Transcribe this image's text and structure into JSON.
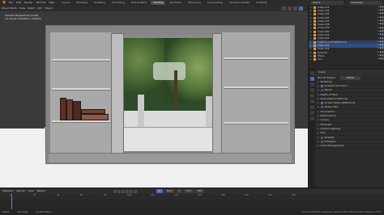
{
  "app": {
    "logo": "blender-logo-icon"
  },
  "menu": [
    "File",
    "Edit",
    "Render",
    "Window",
    "Help"
  ],
  "workspace_tabs": [
    {
      "label": "Layout",
      "active": false
    },
    {
      "label": "Modeling",
      "active": false
    },
    {
      "label": "Sculpting",
      "active": false
    },
    {
      "label": "UV Editing",
      "active": false
    },
    {
      "label": "Texture Paint",
      "active": false
    },
    {
      "label": "Shading",
      "active": true
    },
    {
      "label": "Animation",
      "active": false
    },
    {
      "label": "Rendering",
      "active": false
    },
    {
      "label": "Compositing",
      "active": false
    },
    {
      "label": "Geometry Nodes",
      "active": false
    },
    {
      "label": "Scripting",
      "active": false
    }
  ],
  "scene_selector": "Scene",
  "view_layer": "ViewLayer",
  "viewport": {
    "header_items": [
      "Object Mode",
      "View",
      "Select",
      "Add",
      "Object"
    ],
    "info_line1": "Camera Perspective (Local)",
    "info_line2": "(1) Scene Collection | Camera",
    "accent": "#e88a2a"
  },
  "outliner": {
    "rows": [
      {
        "name": "Cube.133",
        "vis": "▽ ◉ ◧",
        "state": ""
      },
      {
        "name": "Cube.134",
        "vis": "▽ ◉ ◧",
        "state": ""
      },
      {
        "name": "Cube.135",
        "vis": "▽ ◉ ◧",
        "state": ""
      },
      {
        "name": "Cube.136",
        "vis": "▽ ◉ ◧",
        "state": ""
      },
      {
        "name": "Cube.137",
        "vis": "▽ ◉ ◧",
        "state": ""
      },
      {
        "name": "Cube.138",
        "vis": "▽ ◉ ◧",
        "state": ""
      },
      {
        "name": "Cube.139",
        "vis": "▽ ◉ ◧",
        "state": ""
      },
      {
        "name": "Cube.140",
        "vis": "▽ ◉ ◧",
        "state": ""
      },
      {
        "name": "Cube.141",
        "vis": "▽ ◉ ◧",
        "state": ""
      },
      {
        "name": "Cube.142",
        "vis": "▽ ◉ ◧",
        "state": ""
      },
      {
        "name": "Lighting and Reflections",
        "vis": "▽ ◉ ◧",
        "state": "sel2"
      },
      {
        "name": "Cube.143",
        "vis": "▽ ◉ ◧",
        "state": "sel"
      },
      {
        "name": "Cube.144",
        "vis": "▽ ◉ ◧",
        "state": ""
      },
      {
        "name": "Cylinder",
        "vis": "▽ ◉ ◧",
        "state": ""
      },
      {
        "name": "Plane",
        "vis": "▽ ◉ ◧",
        "state": ""
      },
      {
        "name": "Sun",
        "vis": "▽ ◉ ◧",
        "state": ""
      }
    ]
  },
  "properties": {
    "header": "Scene",
    "render_engine_label": "Render Engine",
    "render_engine_value": "Eevee",
    "sections": [
      {
        "label": "Sampling",
        "checkbox": null
      },
      {
        "label": "Ambient Occlusion",
        "checkbox": true
      },
      {
        "label": "Bloom",
        "checkbox": false
      },
      {
        "label": "Depth of Field",
        "checkbox": null
      },
      {
        "label": "Subsurface Scattering",
        "checkbox": null
      },
      {
        "label": "Screen Space Reflections",
        "checkbox": true
      },
      {
        "label": "Motion Blur",
        "checkbox": false
      },
      {
        "label": "Volumetrics",
        "checkbox": null
      },
      {
        "label": "Performance",
        "checkbox": null
      },
      {
        "label": "Curves",
        "checkbox": null
      },
      {
        "label": "Shadows",
        "checkbox": null
      },
      {
        "label": "Indirect Lighting",
        "checkbox": null
      },
      {
        "label": "Film",
        "checkbox": null
      },
      {
        "label": "Simplify",
        "checkbox": false
      },
      {
        "label": "Freestyle",
        "checkbox": false
      },
      {
        "label": "Color Management",
        "checkbox": null
      }
    ]
  },
  "timeline": {
    "menu": [
      "Playback",
      "Keying",
      "View",
      "Marker"
    ],
    "current_frame": "1",
    "start_label": "Start",
    "start": "1",
    "end_label": "End",
    "end": "250",
    "ruler": [
      "0",
      "20",
      "40",
      "60",
      "80",
      "100",
      "120",
      "140",
      "160",
      "180",
      "200",
      "220",
      "240"
    ]
  },
  "status": {
    "left": [
      "Select",
      "Pan View",
      "Context Menu"
    ],
    "right": "Scene Collection | Camera | Verts 4,736 | Faces 4,544 | Objects 1/150"
  }
}
